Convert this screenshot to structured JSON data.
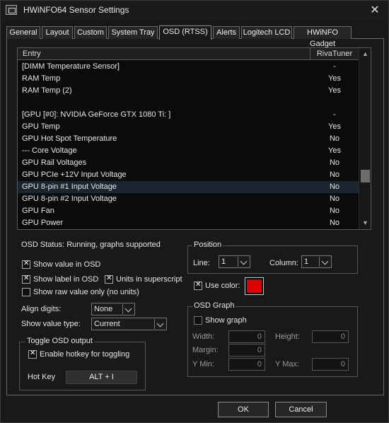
{
  "window": {
    "title": "HWiNFO64 Sensor Settings",
    "close": "✕"
  },
  "tabs": [
    {
      "label": "General"
    },
    {
      "label": "Layout"
    },
    {
      "label": "Custom"
    },
    {
      "label": "System Tray"
    },
    {
      "label": "OSD (RTSS)",
      "active": true
    },
    {
      "label": "Alerts"
    },
    {
      "label": "Logitech LCD"
    },
    {
      "label": "HWiNFO Gadget"
    }
  ],
  "list": {
    "columns": [
      "Entry",
      "RivaTuner"
    ],
    "rows": [
      {
        "name": "[DIMM Temperature Sensor]",
        "value": "-"
      },
      {
        "name": "RAM Temp",
        "value": "Yes"
      },
      {
        "name": "RAM Temp (2)",
        "value": "Yes"
      },
      {
        "name": "",
        "value": ""
      },
      {
        "name": "[GPU [#0]: NVIDIA GeForce GTX 1080 Ti: ]",
        "value": "-"
      },
      {
        "name": "GPU Temp",
        "value": "Yes"
      },
      {
        "name": "GPU Hot Spot Temperature",
        "value": "No"
      },
      {
        "name": "--- Core Voltage",
        "value": "Yes"
      },
      {
        "name": "GPU Rail Voltages",
        "value": "No"
      },
      {
        "name": "GPU PCIe +12V Input Voltage",
        "value": "No"
      },
      {
        "name": "GPU 8-pin #1 Input Voltage",
        "value": "No",
        "selected": true
      },
      {
        "name": "GPU 8-pin #2 Input Voltage",
        "value": "No"
      },
      {
        "name": "GPU Fan",
        "value": "No"
      },
      {
        "name": "GPU Power",
        "value": "No"
      }
    ]
  },
  "osd_status": "OSD Status: Running, graphs supported",
  "options": {
    "show_value": "Show value in OSD",
    "show_label": "Show label in OSD",
    "units_superscript": "Units in superscript",
    "raw_value": "Show raw value only (no units)"
  },
  "align_digits": {
    "label": "Align digits:",
    "value": "None"
  },
  "value_type": {
    "label": "Show value type:",
    "value": "Current"
  },
  "toggle": {
    "title": "Toggle OSD output",
    "enable_hotkey": "Enable hotkey for toggling",
    "hotkey_label": "Hot Key",
    "hotkey_value": "ALT + I"
  },
  "position": {
    "title": "Position",
    "line_label": "Line:",
    "line_value": "1",
    "column_label": "Column:",
    "column_value": "1"
  },
  "use_color": {
    "label": "Use color:",
    "color": "#e00000"
  },
  "graph": {
    "title": "OSD Graph",
    "show_graph": "Show graph",
    "width_label": "Width:",
    "width_value": "0",
    "height_label": "Height:",
    "height_value": "0",
    "margin_label": "Margin:",
    "margin_value": "0",
    "ymin_label": "Y Min:",
    "ymin_value": "0",
    "ymax_label": "Y Max:",
    "ymax_value": "0"
  },
  "buttons": {
    "ok": "OK",
    "cancel": "Cancel"
  }
}
